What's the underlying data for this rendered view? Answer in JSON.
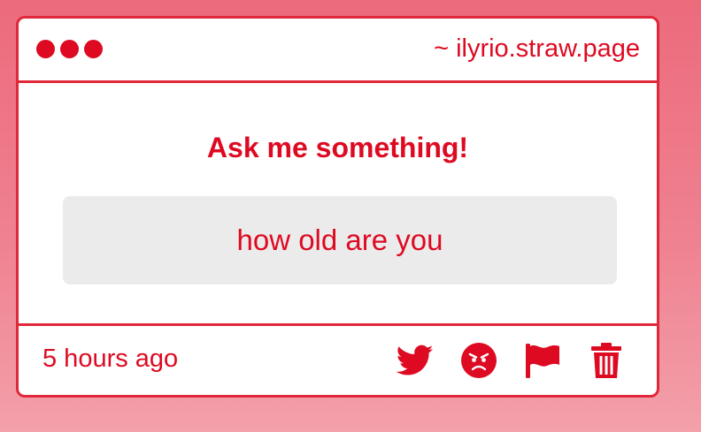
{
  "window": {
    "title": "~ ilyrio.straw.page",
    "dots": [
      "dot",
      "dot",
      "dot"
    ]
  },
  "main": {
    "heading": "Ask me something!",
    "question": "how old are you"
  },
  "footer": {
    "timestamp": "5 hours ago",
    "actions": [
      {
        "icon": "twitter-icon"
      },
      {
        "icon": "angry-face-icon"
      },
      {
        "icon": "flag-icon"
      },
      {
        "icon": "trash-icon"
      }
    ]
  },
  "colors": {
    "accent": "#dd0a22",
    "border": "#e0283a",
    "question_bg": "#ecebec"
  }
}
